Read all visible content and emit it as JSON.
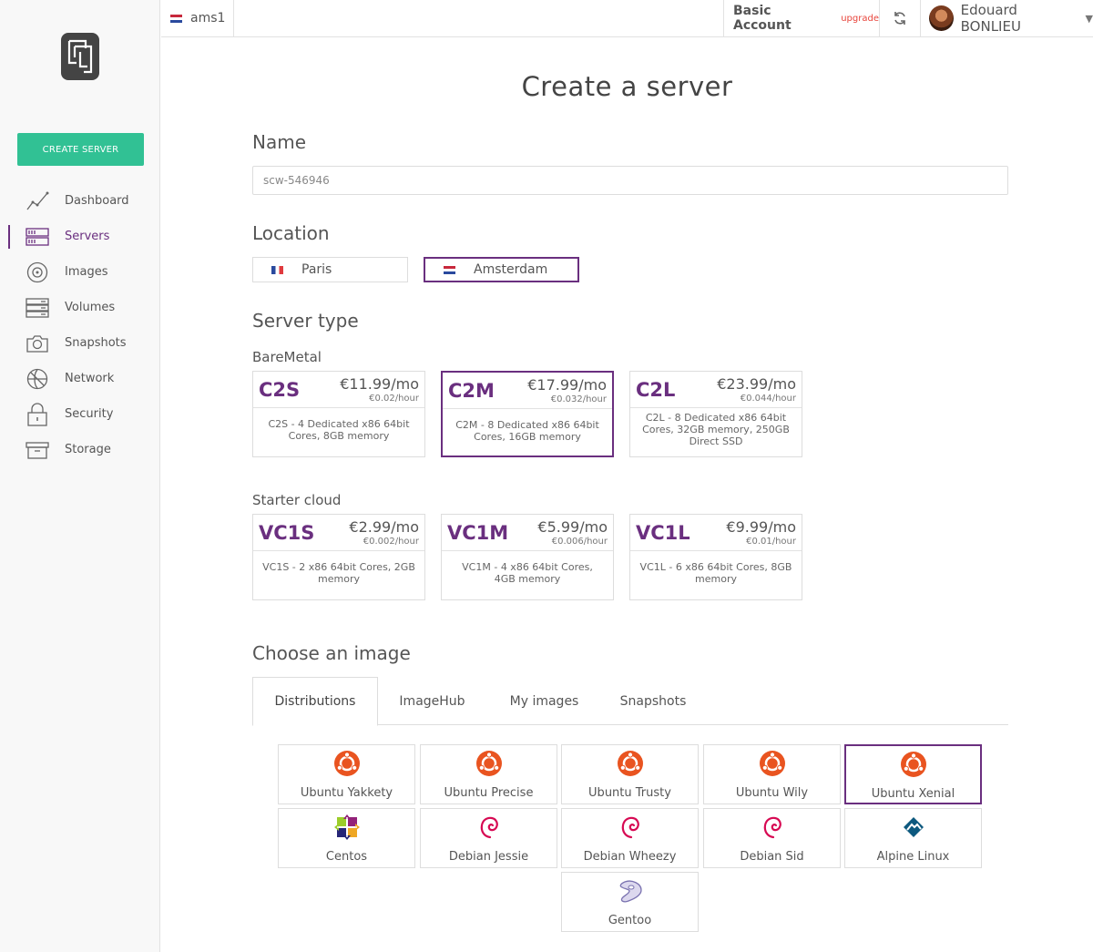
{
  "topbar": {
    "region": "ams1",
    "account_name": "Basic Account",
    "upgrade": "upgrade",
    "user_name": "Edouard BONLIEU"
  },
  "sidebar": {
    "create_button": "CREATE SERVER",
    "items": [
      {
        "label": "Dashboard",
        "icon": "dashboard-icon"
      },
      {
        "label": "Servers",
        "icon": "servers-icon",
        "active": true
      },
      {
        "label": "Images",
        "icon": "images-icon"
      },
      {
        "label": "Volumes",
        "icon": "volumes-icon"
      },
      {
        "label": "Snapshots",
        "icon": "snapshots-icon"
      },
      {
        "label": "Network",
        "icon": "network-icon"
      },
      {
        "label": "Security",
        "icon": "security-icon"
      },
      {
        "label": "Storage",
        "icon": "storage-icon"
      }
    ]
  },
  "page": {
    "title": "Create a server",
    "name_section": "Name",
    "name_value": "scw-546946",
    "location_section": "Location",
    "locations": [
      {
        "label": "Paris",
        "flag": "france-flag"
      },
      {
        "label": "Amsterdam",
        "flag": "netherlands-flag",
        "selected": true
      }
    ],
    "server_type_section": "Server type",
    "baremetal_title": "BareMetal",
    "baremetal": [
      {
        "code": "C2S",
        "price": "€11.99/mo",
        "hour": "€0.02/hour",
        "desc": "C2S - 4 Dedicated x86 64bit Cores, 8GB memory"
      },
      {
        "code": "C2M",
        "price": "€17.99/mo",
        "hour": "€0.032/hour",
        "desc": "C2M - 8 Dedicated x86 64bit Cores, 16GB memory",
        "selected": true
      },
      {
        "code": "C2L",
        "price": "€23.99/mo",
        "hour": "€0.044/hour",
        "desc": "C2L - 8 Dedicated x86 64bit Cores, 32GB memory, 250GB Direct SSD"
      }
    ],
    "starter_title": "Starter cloud",
    "starter": [
      {
        "code": "VC1S",
        "price": "€2.99/mo",
        "hour": "€0.002/hour",
        "desc": "VC1S - 2 x86 64bit Cores, 2GB memory"
      },
      {
        "code": "VC1M",
        "price": "€5.99/mo",
        "hour": "€0.006/hour",
        "desc": "VC1M - 4 x86 64bit Cores, 4GB memory"
      },
      {
        "code": "VC1L",
        "price": "€9.99/mo",
        "hour": "€0.01/hour",
        "desc": "VC1L - 6 x86 64bit Cores, 8GB memory"
      }
    ],
    "image_section": "Choose an image",
    "tabs": [
      "Distributions",
      "ImageHub",
      "My images",
      "Snapshots"
    ],
    "images": [
      {
        "label": "Ubuntu Yakkety",
        "icon": "ubuntu-icon"
      },
      {
        "label": "Ubuntu Precise",
        "icon": "ubuntu-icon"
      },
      {
        "label": "Ubuntu Trusty",
        "icon": "ubuntu-icon"
      },
      {
        "label": "Ubuntu Wily",
        "icon": "ubuntu-icon"
      },
      {
        "label": "Ubuntu Xenial",
        "icon": "ubuntu-icon",
        "selected": true
      },
      {
        "label": "Centos",
        "icon": "centos-icon"
      },
      {
        "label": "Debian Jessie",
        "icon": "debian-icon"
      },
      {
        "label": "Debian Wheezy",
        "icon": "debian-icon"
      },
      {
        "label": "Debian Sid",
        "icon": "debian-icon"
      },
      {
        "label": "Alpine Linux",
        "icon": "alpine-icon"
      },
      {
        "label": "Gentoo",
        "icon": "gentoo-icon"
      }
    ]
  },
  "colors": {
    "accent": "#6a2f7f",
    "create_button": "#31c194",
    "upgrade": "#e8453c",
    "ubuntu": "#e95420"
  }
}
